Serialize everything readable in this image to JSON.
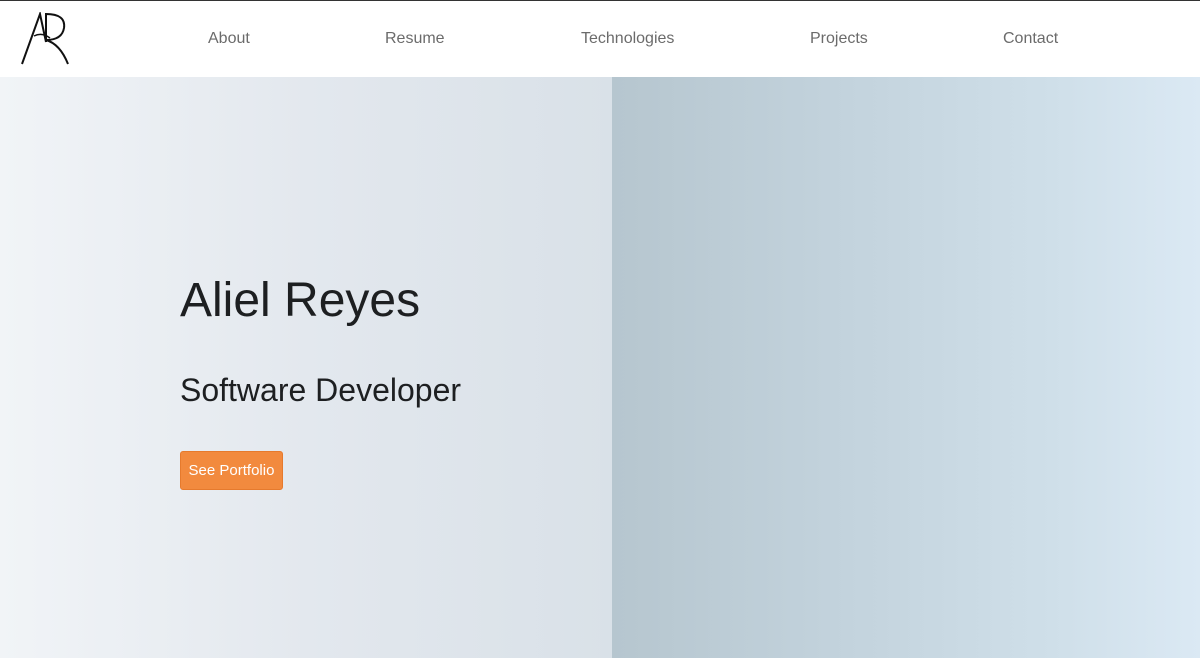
{
  "logo": {
    "text": "AR"
  },
  "nav": {
    "about": "About",
    "resume": "Resume",
    "technologies": "Technologies",
    "projects": "Projects",
    "contact": "Contact"
  },
  "hero": {
    "name": "Aliel Reyes",
    "title": "Software Developer",
    "button_label": "See Portfolio"
  },
  "colors": {
    "accent": "#f28a3e",
    "text": "#1d1f21",
    "nav_text": "#6b6b6b"
  }
}
